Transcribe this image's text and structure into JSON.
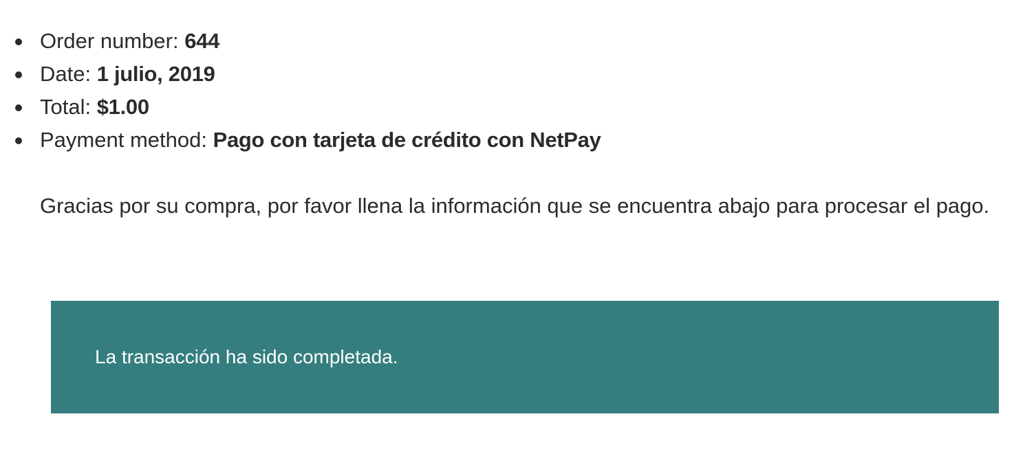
{
  "order": {
    "items": [
      {
        "label": "Order number: ",
        "value": "644"
      },
      {
        "label": "Date: ",
        "value": "1 julio, 2019"
      },
      {
        "label": "Total: ",
        "value": "$1.00"
      },
      {
        "label": "Payment method: ",
        "value": "Pago con tarjeta de crédito con NetPay"
      }
    ]
  },
  "thanks_text": "Gracias por su compra, por favor llena la información que se encuentra abajo para procesar el pago.",
  "notice": {
    "text": "La transacción ha sido completada.",
    "background_color": "#357e7f",
    "text_color": "#ffffff"
  }
}
